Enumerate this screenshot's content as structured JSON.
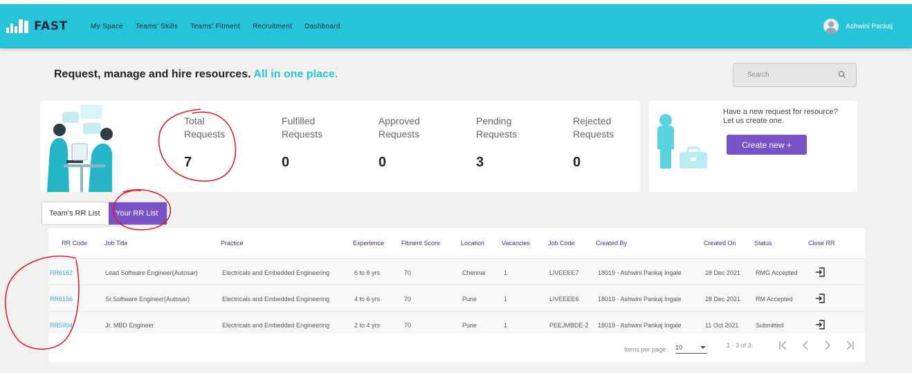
{
  "app": {
    "logo_text": "FAST"
  },
  "nav": {
    "links": [
      "My Space",
      "Teams' Skills",
      "Teams' Fitment",
      "Recruitment",
      "Dashboard"
    ],
    "user_name": "Ashwini Pankaj"
  },
  "header": {
    "tagline_main": "Request, manage and hire resources.",
    "tagline_highlight": "All in one place.",
    "search_placeholder": "Search"
  },
  "stats": [
    {
      "label": "Total\nRequests",
      "value": "7"
    },
    {
      "label": "Fulfilled\nRequests",
      "value": "0"
    },
    {
      "label": "Approved\nRequests",
      "value": "0"
    },
    {
      "label": "Pending\nRequests",
      "value": "3"
    },
    {
      "label": "Rejected\nRequests",
      "value": "0"
    }
  ],
  "new_request": {
    "text": "Have a new request for resource? Let us create one.",
    "button_label": "Create new +"
  },
  "toggle": {
    "team_label": "Team's RR List",
    "your_label": "Your RR List",
    "active": "your"
  },
  "table": {
    "columns": [
      "RR Code",
      "Job Title",
      "Practice",
      "Experience",
      "Fitment Score",
      "Location",
      "Vacancies",
      "Job Code",
      "Created By",
      "Created On",
      "Status",
      "Close RR"
    ],
    "rows": [
      [
        "RR6162",
        "Lead Software Engineer(Autosar)",
        "Electricals and Embedded Engineering",
        "6 to 8 yrs",
        "70",
        "Chennai",
        "1",
        "LIVEEEE7",
        "18019 - Ashwini Pankaj Ingale",
        "28 Dec 2021",
        "RMG Accepted"
      ],
      [
        "RR6156",
        "Sr.Software Engineer(Autosar)",
        "Electricals and Embedded Engineering",
        "4 to 6 yrs",
        "70",
        "Pune",
        "1",
        "LIVEEEE6",
        "18019 - Ashwini Pankaj Ingale",
        "28 Dec 2021",
        "RM Accepted"
      ],
      [
        "RR5994",
        "Jr. MBD Engineer",
        "Electricals and Embedded Engineering",
        "2 to 4 yrs",
        "70",
        "Pune",
        "1",
        "PEEJMBDE-2",
        "18019 - Ashwini Pankaj Ingale",
        "11 Oct 2021",
        "Submitted"
      ]
    ]
  },
  "paginator": {
    "items_per_page_label": "Items per page:",
    "items_per_page_value": "10",
    "range_label": "1 - 3 of 3"
  },
  "colors": {
    "navbar": "#26c4d8",
    "accent_purple": "#7a52c8",
    "annotation_red": "#e0141e"
  },
  "icons": [
    "search-icon",
    "close-rr-icon",
    "first-page-icon",
    "prev-page-icon",
    "next-page-icon",
    "last-page-icon"
  ]
}
